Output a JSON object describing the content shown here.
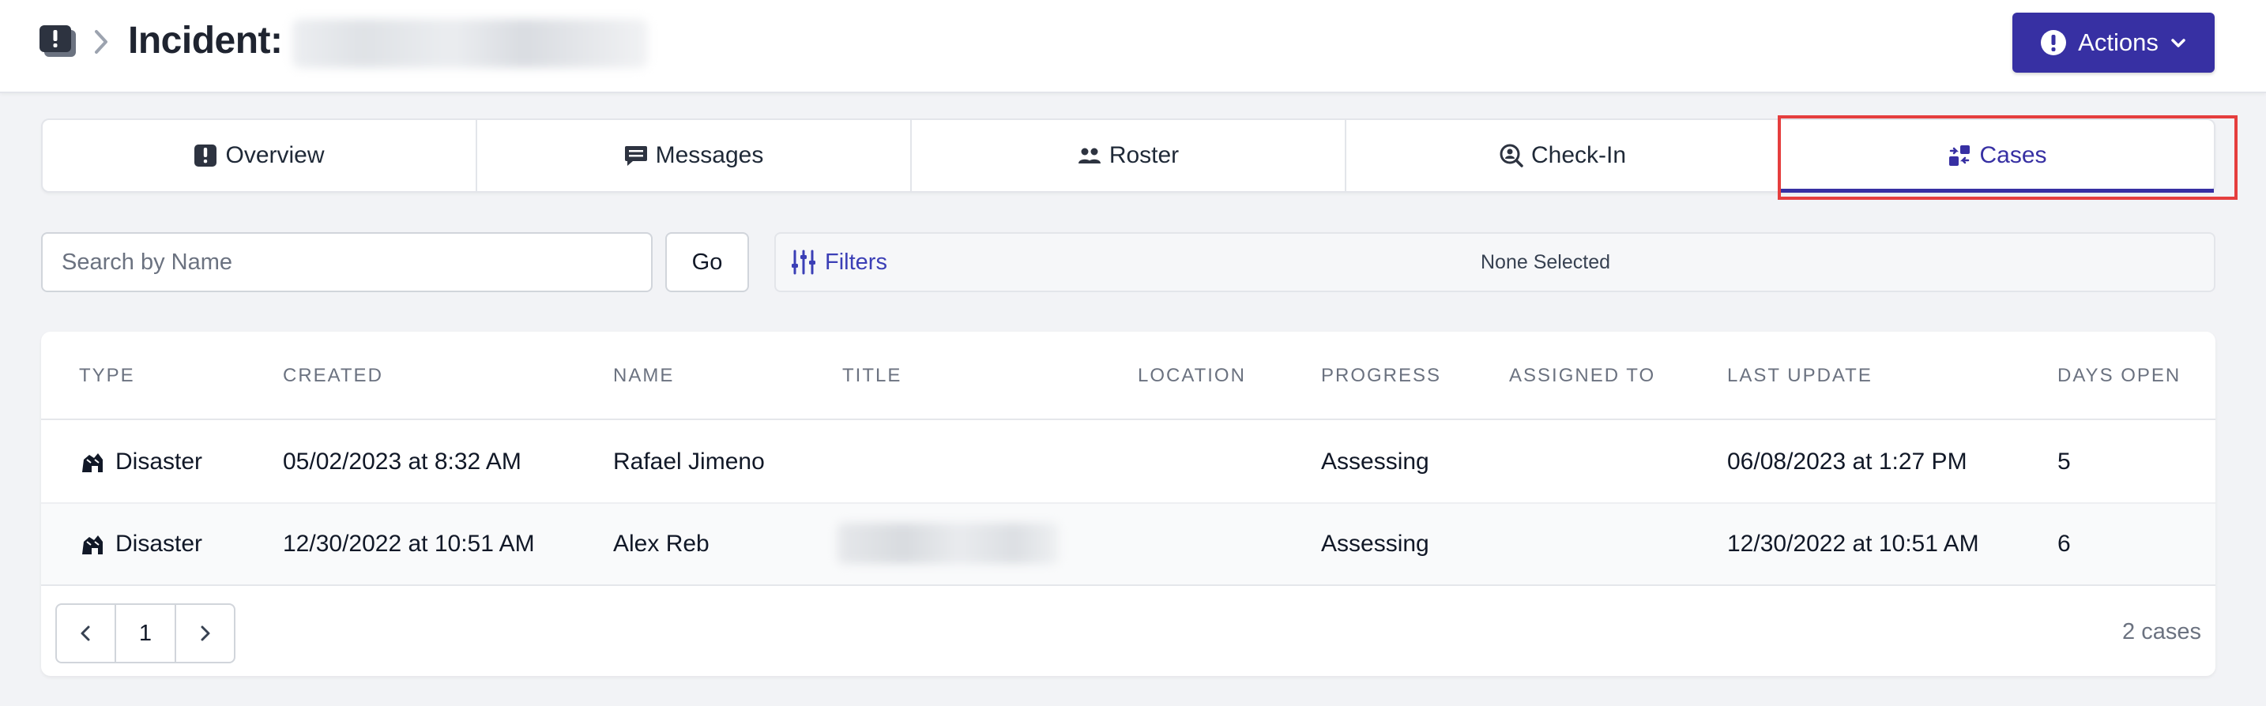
{
  "header": {
    "title": "Incident:",
    "actions_label": "Actions"
  },
  "tabs": [
    {
      "label": "Overview",
      "icon": "alert-square-icon",
      "active": false
    },
    {
      "label": "Messages",
      "icon": "message-icon",
      "active": false
    },
    {
      "label": "Roster",
      "icon": "people-icon",
      "active": false
    },
    {
      "label": "Check-In",
      "icon": "user-search-icon",
      "active": false
    },
    {
      "label": "Cases",
      "icon": "cases-icon",
      "active": true
    }
  ],
  "search": {
    "placeholder": "Search by Name",
    "value": "",
    "go_label": "Go"
  },
  "filters": {
    "label": "Filters",
    "selected_text": "None Selected"
  },
  "table": {
    "columns": [
      "TYPE",
      "CREATED",
      "NAME",
      "TITLE",
      "LOCATION",
      "PROGRESS",
      "ASSIGNED TO",
      "LAST UPDATE",
      "DAYS OPEN"
    ],
    "rows": [
      {
        "type": "Disaster",
        "created": "05/02/2023 at 8:32 AM",
        "name": "Rafael Jimeno",
        "title": "",
        "location": "",
        "progress": "Assessing",
        "assigned_to": "",
        "last_update": "06/08/2023 at 1:27 PM",
        "days_open": "5"
      },
      {
        "type": "Disaster",
        "created": "12/30/2022 at 10:51 AM",
        "name": "Alex Reb",
        "title": "",
        "location": "",
        "progress": "Assessing",
        "assigned_to": "",
        "last_update": "12/30/2022 at 10:51 AM",
        "days_open": "6"
      }
    ]
  },
  "pagination": {
    "current_page": "1",
    "count_text": "2 cases"
  },
  "colors": {
    "accent": "#3730a3",
    "highlight": "#e53e3e",
    "background": "#f2f3f6"
  }
}
